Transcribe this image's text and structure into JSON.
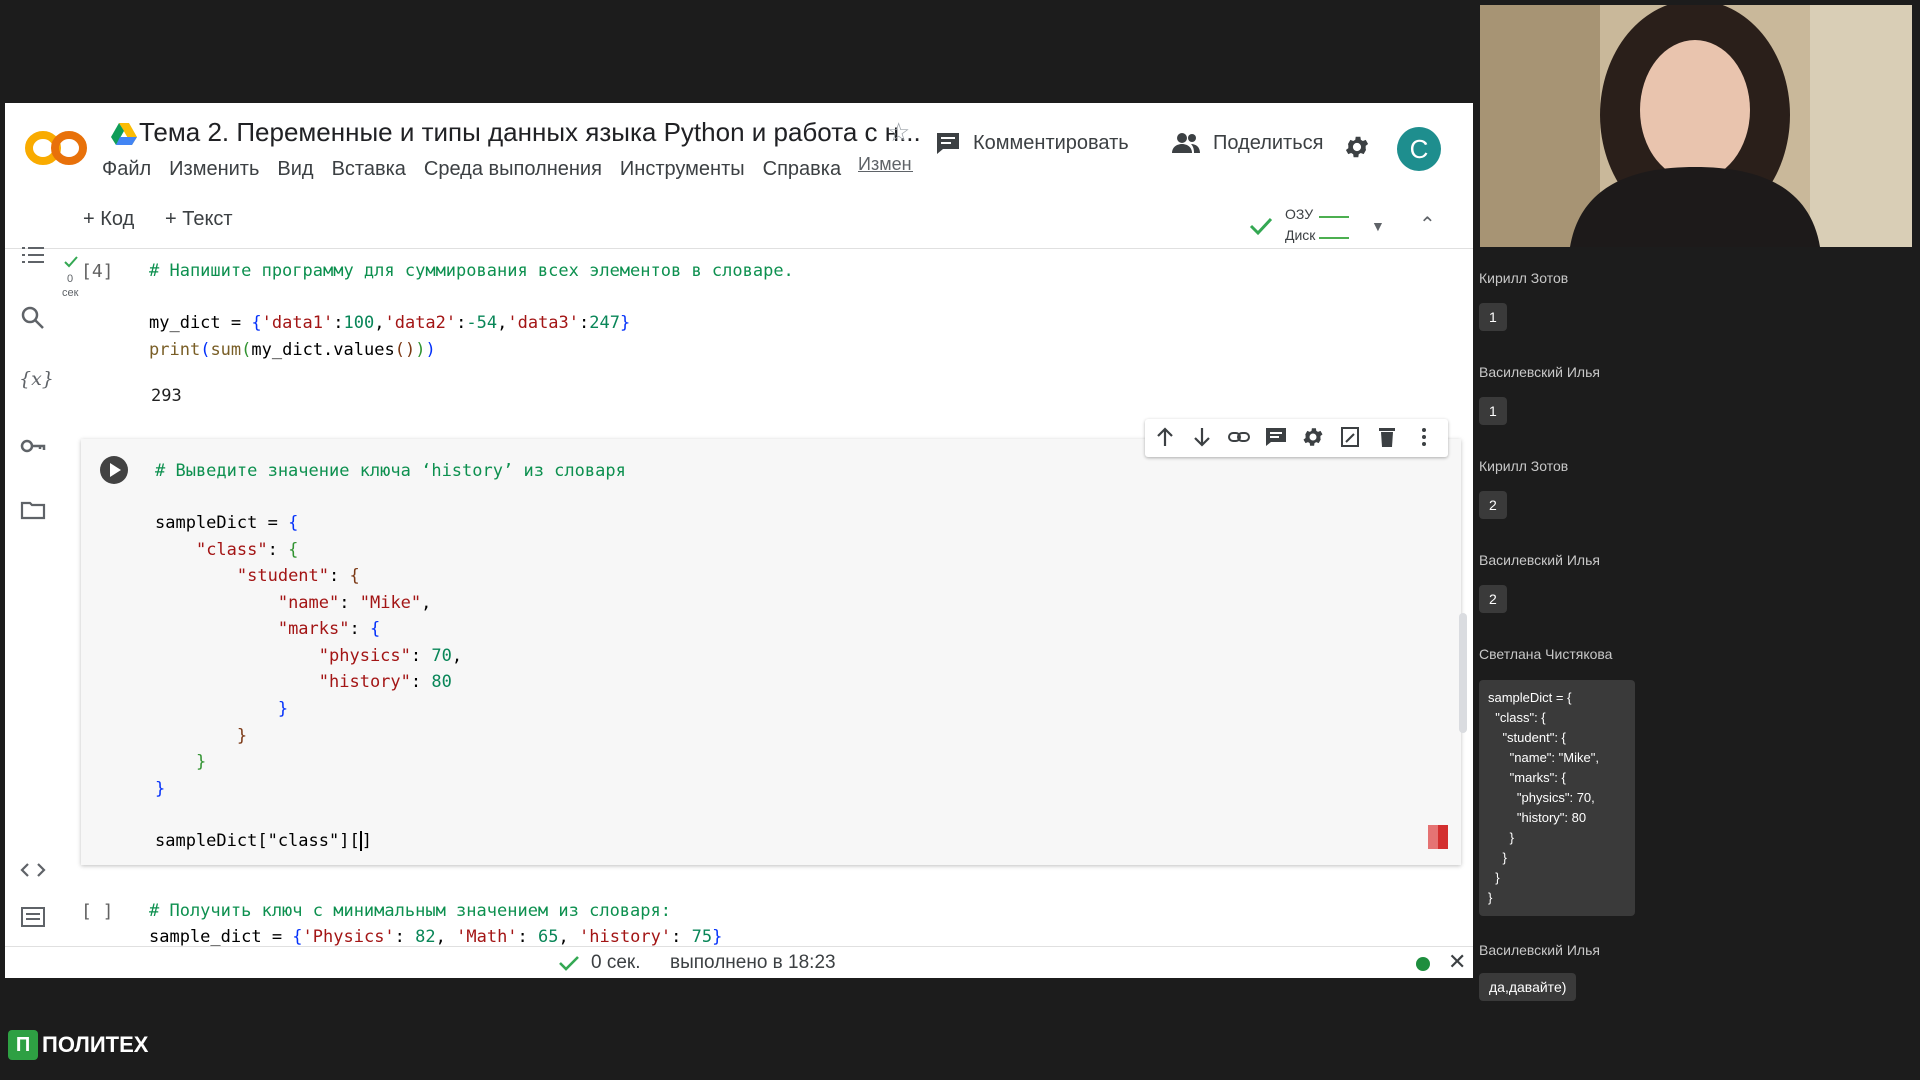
{
  "colab": {
    "title": "Тема 2. Переменные и типы данных языка Python и работа с н...",
    "menu": [
      "Файл",
      "Изменить",
      "Вид",
      "Вставка",
      "Среда выполнения",
      "Инструменты",
      "Справка"
    ],
    "changes_link": "Измен... сохра...",
    "comment_label": "Комментировать",
    "share_label": "Поделиться",
    "avatar_letter": "C",
    "toolbar": {
      "add_code": "+ Код",
      "add_text": "+ Текст",
      "ram": "ОЗУ",
      "disk": "Диск"
    }
  },
  "cells": {
    "c1": {
      "exec_count": "[4]",
      "time_value": "0",
      "time_unit": "сек",
      "comment": "# Напишите программу для суммирования всех элементов в словаре.",
      "output": "293"
    },
    "c2": {
      "comment": "# Выведите значение ключа ‘history’ из словаря",
      "last_line_prefix": "sampleDict[\"class\"][",
      "last_line_cursor": "]"
    },
    "c3": {
      "exec_count": "[ ]",
      "comment": "# Получить ключ с минимальным значением из словаря:"
    }
  },
  "status": {
    "elapsed": "0 сек.",
    "completed": "выполнено в 18:23"
  },
  "chat": {
    "messages": [
      {
        "name": "Кирилл Зотов",
        "text": "1"
      },
      {
        "name": "Василевский Илья",
        "text": "1"
      },
      {
        "name": "Кирилл Зотов",
        "text": "2"
      },
      {
        "name": "Василевский Илья",
        "text": "2"
      },
      {
        "name": "Светлана Чистякова",
        "text": "sampleDict = {\n  \"class\": {\n    \"student\": {\n      \"name\": \"Mike\",\n      \"marks\": {\n        \"physics\": 70,\n        \"history\": 80\n      }\n    }\n  }\n}"
      },
      {
        "name": "Василевский Илья",
        "text": "да,давайте)"
      }
    ]
  },
  "brand": {
    "logo_letters": "П",
    "name": "ПОЛИТЕХ"
  }
}
